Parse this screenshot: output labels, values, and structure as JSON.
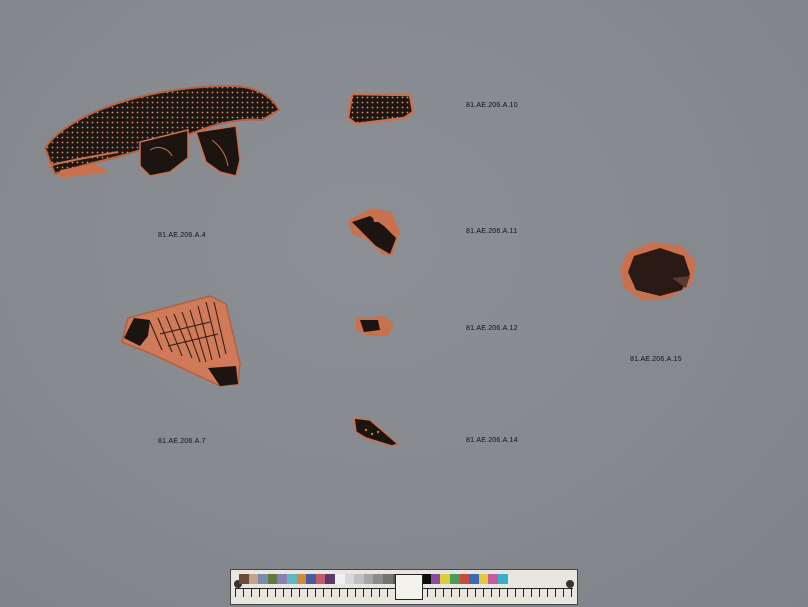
{
  "image": {
    "subject": "Red-figure pottery fragments on a grey background with a color and scale reference bar"
  },
  "labels": {
    "a4": "81.AE.206.A.4",
    "a7": "81.AE.206.A.7",
    "a10": "81.AE.206.A.10",
    "a11": "81.AE.206.A.11",
    "a12": "81.AE.206.A.12",
    "a14": "81.AE.206.A.14",
    "a15": "81.AE.206.A.15"
  },
  "colors": {
    "background": "#878b90",
    "terracotta": "#c9714f",
    "black_glaze": "#1c1410",
    "label_text": "#111111"
  },
  "scale_bar": {
    "swatch_colors": [
      "#6b4a3a",
      "#c9a08a",
      "#7a8bb0",
      "#5f7a3f",
      "#8a7fb0",
      "#5fb8c8",
      "#d08a3a",
      "#4a5aa0",
      "#c25a6a",
      "#5a3a6a",
      "#f0f0f0",
      "#d8d8d8",
      "#bfbfbf",
      "#a6a6a6",
      "#8c8c8c",
      "#737373",
      "#595959",
      "#404040",
      "#262626",
      "#0d0d0d",
      "#8a4aa0",
      "#d8d03a",
      "#4a9a5a",
      "#c84a3a",
      "#3a6ab0",
      "#e6c83a",
      "#c85aa0",
      "#3ab0c8"
    ]
  }
}
